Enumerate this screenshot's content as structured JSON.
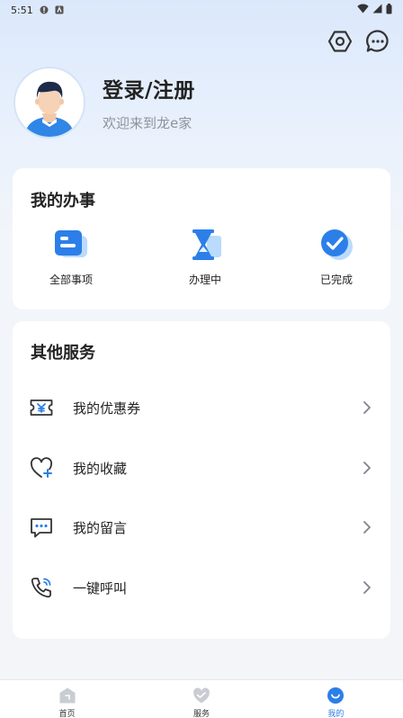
{
  "status_bar": {
    "time": "5:51"
  },
  "profile": {
    "login_title": "登录/注册",
    "welcome": "欢迎来到龙e家"
  },
  "affairs": {
    "title": "我的办事",
    "items": [
      {
        "label": "全部事项",
        "icon": "document-list-icon"
      },
      {
        "label": "办理中",
        "icon": "hourglass-icon"
      },
      {
        "label": "已完成",
        "icon": "checkmark-icon"
      }
    ]
  },
  "services": {
    "title": "其他服务",
    "items": [
      {
        "label": "我的优惠券",
        "icon": "coupon-icon"
      },
      {
        "label": "我的收藏",
        "icon": "heart-icon"
      },
      {
        "label": "我的留言",
        "icon": "message-icon"
      },
      {
        "label": "一键呼叫",
        "icon": "phone-call-icon"
      }
    ]
  },
  "bottom_nav": {
    "items": [
      {
        "label": "首页",
        "icon": "home-icon"
      },
      {
        "label": "服务",
        "icon": "service-heart-icon"
      },
      {
        "label": "我的",
        "icon": "profile-icon"
      }
    ],
    "active": "我的"
  },
  "colors": {
    "accent": "#2c7fe8",
    "nav_inactive_icon": "#c9cdd3"
  }
}
